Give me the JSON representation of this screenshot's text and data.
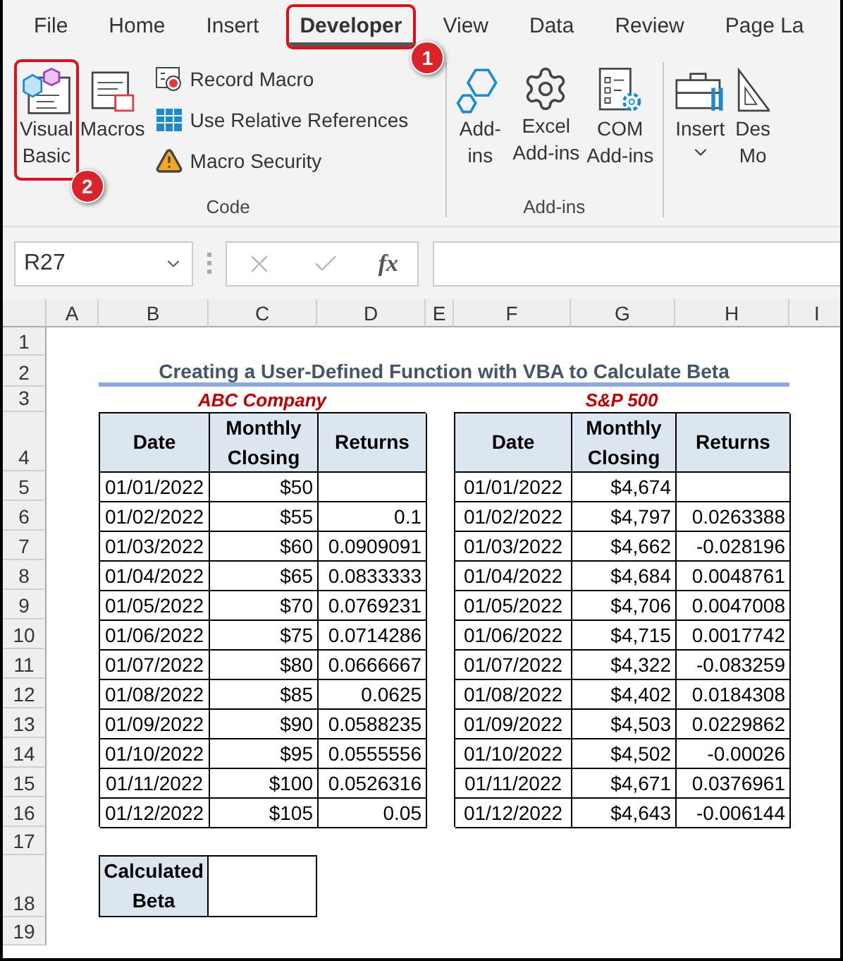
{
  "ribbon_tabs": [
    {
      "label": "File",
      "selected": false
    },
    {
      "label": "Home",
      "selected": false
    },
    {
      "label": "Insert",
      "selected": false
    },
    {
      "label": "Developer",
      "selected": true,
      "callout": "1"
    },
    {
      "label": "View",
      "selected": false
    },
    {
      "label": "Data",
      "selected": false
    },
    {
      "label": "Review",
      "selected": false
    },
    {
      "label": "Page La",
      "selected": false
    }
  ],
  "ribbon_groups": [
    {
      "label": "Code",
      "buttons": [
        {
          "kind": "visual-basic",
          "lines": [
            "Visual",
            "Basic"
          ],
          "callout": "2"
        },
        {
          "kind": "macros",
          "lines": [
            "Macros"
          ]
        }
      ],
      "small_buttons": [
        {
          "kind": "record",
          "label": "Record Macro"
        },
        {
          "kind": "relative",
          "label": "Use Relative References"
        },
        {
          "kind": "security",
          "label": "Macro Security"
        }
      ]
    },
    {
      "label": "Add-ins",
      "buttons": [
        {
          "kind": "addins",
          "lines": [
            "Add-",
            "ins"
          ]
        },
        {
          "kind": "excel-addins",
          "lines": [
            "Excel",
            "Add-ins"
          ]
        },
        {
          "kind": "com-addins",
          "lines": [
            "COM",
            "Add-ins"
          ]
        }
      ]
    },
    {
      "buttons": [
        {
          "kind": "insert",
          "lines": [
            "Insert"
          ],
          "dropdown": true
        },
        {
          "kind": "design",
          "lines": [
            "Des",
            "Mo"
          ]
        }
      ]
    }
  ],
  "formula_bar": {
    "name_box": "R27",
    "function_label": "fx"
  },
  "columns": [
    "A",
    "B",
    "C",
    "D",
    "E",
    "F",
    "G",
    "H",
    "I"
  ],
  "row_numbers": [
    "1",
    "2",
    "3",
    "4",
    "5",
    "6",
    "7",
    "8",
    "9",
    "10",
    "11",
    "12",
    "13",
    "14",
    "15",
    "16",
    "17",
    "18",
    "19"
  ],
  "sheet": {
    "title": "Creating a User-Defined Function with VBA to Calculate Beta",
    "tables": [
      {
        "heading": "ABC Company",
        "columns": [
          "Date",
          "Monthly Closing",
          "Returns"
        ],
        "rows": [
          [
            "01/01/2022",
            "$50",
            ""
          ],
          [
            "01/02/2022",
            "$55",
            "0.1"
          ],
          [
            "01/03/2022",
            "$60",
            "0.0909091"
          ],
          [
            "01/04/2022",
            "$65",
            "0.0833333"
          ],
          [
            "01/05/2022",
            "$70",
            "0.0769231"
          ],
          [
            "01/06/2022",
            "$75",
            "0.0714286"
          ],
          [
            "01/07/2022",
            "$80",
            "0.0666667"
          ],
          [
            "01/08/2022",
            "$85",
            "0.0625"
          ],
          [
            "01/09/2022",
            "$90",
            "0.0588235"
          ],
          [
            "01/10/2022",
            "$95",
            "0.0555556"
          ],
          [
            "01/11/2022",
            "$100",
            "0.0526316"
          ],
          [
            "01/12/2022",
            "$105",
            "0.05"
          ]
        ]
      },
      {
        "heading": "S&P 500",
        "columns": [
          "Date",
          "Monthly Closing",
          "Returns"
        ],
        "rows": [
          [
            "01/01/2022",
            "$4,674",
            ""
          ],
          [
            "01/02/2022",
            "$4,797",
            "0.0263388"
          ],
          [
            "01/03/2022",
            "$4,662",
            "-0.028196"
          ],
          [
            "01/04/2022",
            "$4,684",
            "0.0048761"
          ],
          [
            "01/05/2022",
            "$4,706",
            "0.0047008"
          ],
          [
            "01/06/2022",
            "$4,715",
            "0.0017742"
          ],
          [
            "01/07/2022",
            "$4,322",
            "-0.083259"
          ],
          [
            "01/08/2022",
            "$4,402",
            "0.0184308"
          ],
          [
            "01/09/2022",
            "$4,503",
            "0.0229862"
          ],
          [
            "01/10/2022",
            "$4,502",
            "-0.00026"
          ],
          [
            "01/11/2022",
            "$4,671",
            "0.0376961"
          ],
          [
            "01/12/2022",
            "$4,643",
            "-0.006144"
          ]
        ]
      }
    ],
    "beta_label": "Calculated Beta"
  }
}
